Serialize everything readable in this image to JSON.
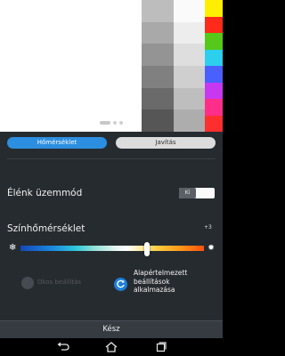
{
  "preview": {
    "gray_column_1": [
      "#bdbdbd",
      "#a9a9a9",
      "#949494",
      "#808080",
      "#6a6a6a",
      "#565656"
    ],
    "gray_column_2": [
      "#fafafa",
      "#ededed",
      "#dedede",
      "#cfcfcf",
      "#bebebe",
      "#adadad"
    ],
    "color_column": [
      "#ffee00",
      "#ff2a1a",
      "#55c81a",
      "#2ccfee",
      "#4a5fff",
      "#c838f0",
      "#ff2e8a",
      "#ff2e2e"
    ],
    "page_indicator": {
      "count": 3,
      "active": 0
    }
  },
  "tabs": [
    {
      "label": "Hőmérséklet",
      "selected": true
    },
    {
      "label": "Javítás",
      "selected": false
    }
  ],
  "vivid_mode": {
    "label": "Élénk üzemmód",
    "toggle_label": "Ki",
    "enabled": false
  },
  "color_temperature": {
    "label": "Színhőmérséklet",
    "value_text": "+3",
    "value": 3,
    "min_icon": "snowflake-icon",
    "max_icon": "sun-icon",
    "position_fraction": 0.69
  },
  "smart_button": {
    "label": "Okos beállítás",
    "enabled": false
  },
  "reset_button": {
    "label": "Alapértelmezett beállítások alkalmazása"
  },
  "done_label": "Kész",
  "nav": {
    "back_icon": "back-icon",
    "home_icon": "home-icon",
    "recent_icon": "recent-apps-icon"
  },
  "colors": {
    "accent": "#2c8ee0",
    "panel": "#262b30",
    "done_bar": "#353b41"
  }
}
